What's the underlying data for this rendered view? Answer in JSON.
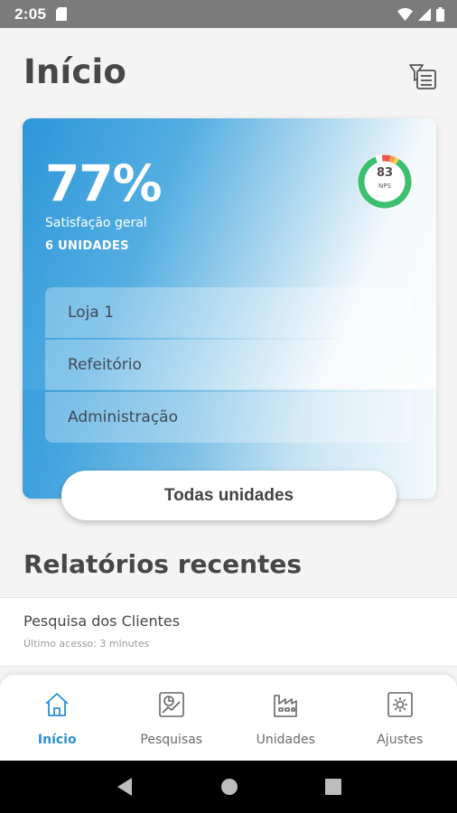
{
  "status_bar": {
    "time": "2:05"
  },
  "header": {
    "title": "Início"
  },
  "hero": {
    "percent": "77%",
    "satisfaction_label": "Satisfação geral",
    "units_label": "6 UNIDADES",
    "nps": {
      "value": "83",
      "label": "NPS"
    },
    "units": [
      {
        "label": "Loja 1"
      },
      {
        "label": "Refeitório"
      },
      {
        "label": "Administração"
      }
    ],
    "all_units_label": "Todas unidades"
  },
  "reports": {
    "title": "Relatórios recentes",
    "items": [
      {
        "name": "Pesquisa dos Clientes",
        "last_access": "Último acesso: 3 minutes"
      }
    ]
  },
  "bottom_nav": {
    "items": [
      {
        "label": "Início",
        "icon": "home-icon",
        "active": true
      },
      {
        "label": "Pesquisas",
        "icon": "survey-icon",
        "active": false
      },
      {
        "label": "Unidades",
        "icon": "factory-icon",
        "active": false
      },
      {
        "label": "Ajustes",
        "icon": "settings-icon",
        "active": false
      }
    ]
  },
  "colors": {
    "accent": "#2d8fcf",
    "nps_green": "#3cbf6e",
    "nps_red": "#e9574f",
    "nps_orange": "#f2a24a",
    "nps_yellow": "#f4d35a"
  }
}
